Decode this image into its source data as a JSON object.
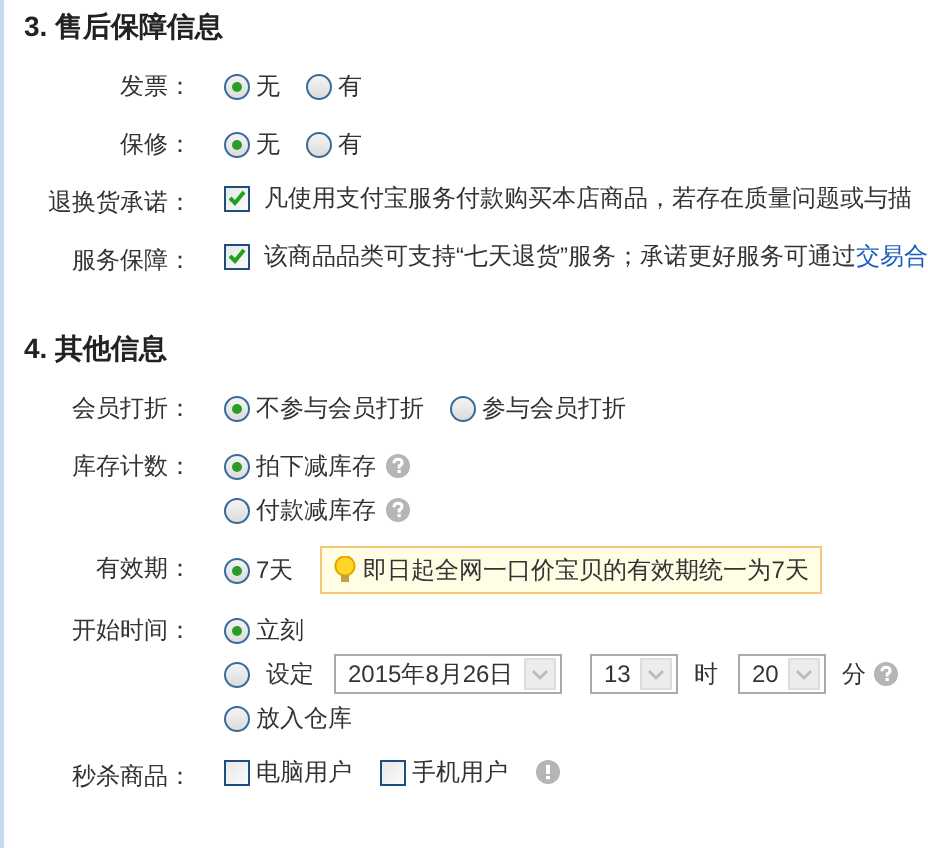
{
  "sections": [
    {
      "title": "3. 售后保障信息",
      "rows": [
        {
          "kind": "radio",
          "label": "发票：",
          "options": [
            {
              "kind": "plain",
              "label": "无",
              "selected": true
            },
            {
              "kind": "plain",
              "label": "有",
              "selected": false
            }
          ]
        },
        {
          "kind": "radio",
          "label": "保修：",
          "options": [
            {
              "kind": "plain",
              "label": "无",
              "selected": true
            },
            {
              "kind": "plain",
              "label": "有",
              "selected": false
            }
          ]
        },
        {
          "kind": "promise",
          "label": "退换货承诺：",
          "checked": true,
          "text": "凡使用支付宝服务付款购买本店商品，若存在质量问题或与描"
        },
        {
          "kind": "promise",
          "label": "服务保障：",
          "checked": true,
          "text": "该商品品类可支持“七天退货”服务；承诺更好服务可通过",
          "link": "交易合"
        }
      ]
    },
    {
      "title": "4. 其他信息",
      "rows": [
        {
          "kind": "radio",
          "label": "会员打折：",
          "options": [
            {
              "kind": "plain",
              "label": "不参与会员打折",
              "selected": true
            },
            {
              "kind": "plain",
              "label": "参与会员打折",
              "selected": false
            }
          ]
        },
        {
          "kind": "radio_stack",
          "label": "库存计数：",
          "options": [
            {
              "kind": "help",
              "label": "拍下减库存",
              "selected": true
            },
            {
              "kind": "help",
              "label": "付款减库存",
              "selected": false
            }
          ]
        },
        {
          "kind": "notice",
          "label": "有效期：",
          "options": [
            {
              "kind": "plain",
              "label": "7天",
              "selected": true
            }
          ],
          "notice": "即日起全网一口价宝贝的有效期统一为7天"
        },
        {
          "kind": "radio_stack",
          "label": "开始时间：",
          "options": [
            {
              "kind": "plain",
              "label": "立刻",
              "selected": true
            },
            {
              "kind": "schedule",
              "label": "设定",
              "selected": false,
              "date": "2015年8月26日",
              "hour": "13",
              "hour_unit": "时",
              "minute": "20",
              "minute_unit": "分"
            },
            {
              "kind": "plain",
              "label": "放入仓库",
              "selected": false
            }
          ]
        },
        {
          "kind": "checks",
          "label": "秒杀商品：",
          "options": [
            {
              "label": "电脑用户",
              "checked": false
            },
            {
              "label": "手机用户",
              "checked": false
            }
          ]
        }
      ]
    }
  ]
}
